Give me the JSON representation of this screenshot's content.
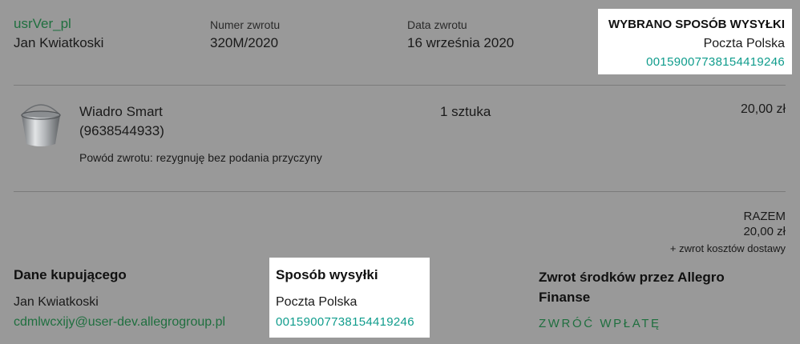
{
  "header": {
    "user_login": "usrVer_pl",
    "buyer_name": "Jan Kwiatkoski",
    "return_number_label": "Numer zwrotu",
    "return_number_value": "320M/2020",
    "return_date_label": "Data zwrotu",
    "return_date_value": "16 września 2020",
    "selected_shipping": {
      "title": "WYBRANO SPOSÓB WYSYŁKI",
      "carrier": "Poczta Polska",
      "tracking": "00159007738154419246"
    }
  },
  "item": {
    "icon": "bucket-icon",
    "name": "Wiadro Smart",
    "offer_id": "(9638544933)",
    "quantity": "1 sztuka",
    "price": "20,00 zł",
    "reason_label": "Powód zwrotu:",
    "reason_value": "rezygnuję bez podania przyczyny"
  },
  "totals": {
    "label": "RAZEM",
    "value": "20,00 zł",
    "note": "+ zwrot kosztów dostawy"
  },
  "buyer_data": {
    "title": "Dane kupującego",
    "name": "Jan Kwiatkoski",
    "email": "cdmlwcxijy@user-dev.allegrogroup.pl"
  },
  "shipping": {
    "title": "Sposób wysyłki",
    "carrier": "Poczta Polska",
    "tracking": "00159007738154419246"
  },
  "refund": {
    "title": "Zwrot środków przez Allegro Finanse",
    "button": "ZWRÓĆ WPŁATĘ"
  },
  "colors": {
    "background": "#999999",
    "link_green": "#1f6f3f",
    "tracking_teal": "#0f9c8c"
  }
}
